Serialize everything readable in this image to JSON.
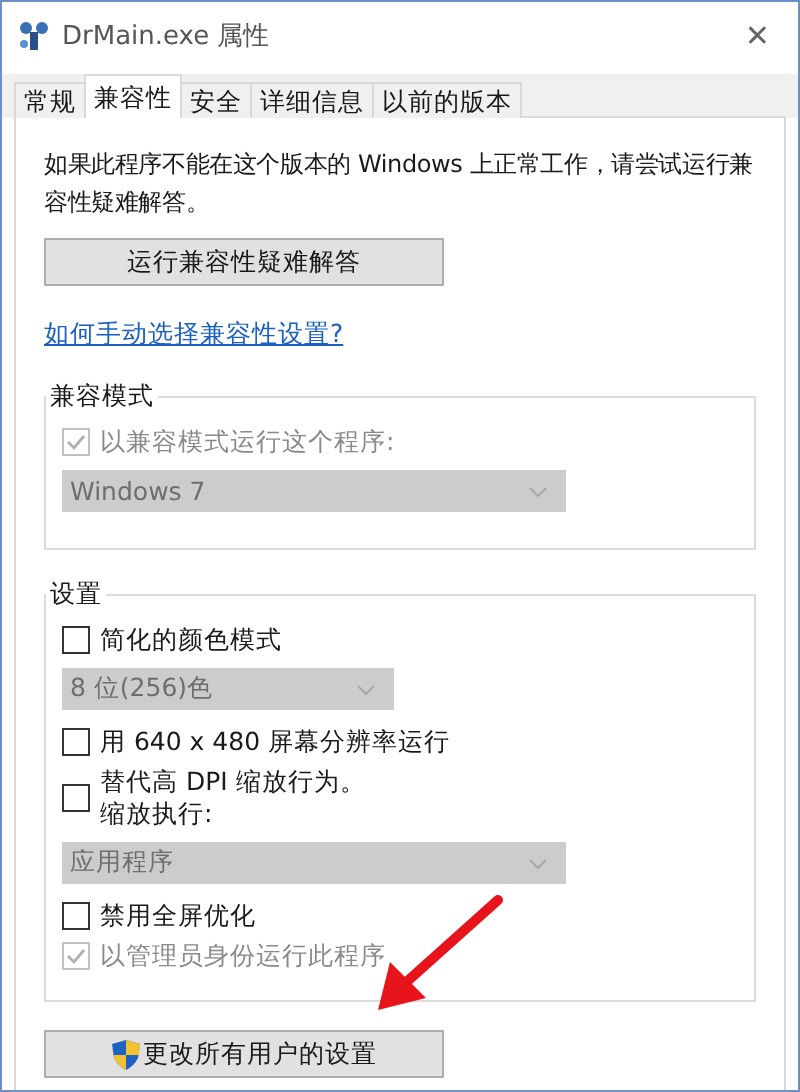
{
  "window": {
    "title": "DrMain.exe 属性",
    "close": "✕"
  },
  "tabs": [
    {
      "label": "常规",
      "selected": false
    },
    {
      "label": "兼容性",
      "selected": true
    },
    {
      "label": "安全",
      "selected": false
    },
    {
      "label": "详细信息",
      "selected": false
    },
    {
      "label": "以前的版本",
      "selected": false
    }
  ],
  "intro": "如果此程序不能在这个版本的 Windows 上正常工作，请尝试运行兼容性疑难解答。",
  "troubleshoot_button": "运行兼容性疑难解答",
  "help_link": "如何手动选择兼容性设置?",
  "groups": [
    {
      "title": "兼容模式",
      "items": [
        {
          "kind": "checkbox",
          "label": "以兼容模式运行这个程序:",
          "checked": true,
          "disabled": true
        },
        {
          "kind": "dropdown",
          "value": "Windows 7",
          "disabled": true
        }
      ]
    },
    {
      "title": "设置",
      "items": [
        {
          "kind": "checkbox",
          "label": "简化的颜色模式",
          "checked": false,
          "disabled": false
        },
        {
          "kind": "dropdown",
          "value": "8 位(256)色",
          "disabled": true,
          "short": true
        },
        {
          "kind": "checkbox",
          "label": "用 640 x 480 屏幕分辨率运行",
          "checked": false,
          "disabled": false
        },
        {
          "kind": "checkbox",
          "label": "替代高 DPI 缩放行为。",
          "label_2": "缩放执行:",
          "checked": false,
          "disabled": false
        },
        {
          "kind": "dropdown",
          "value": "应用程序",
          "disabled": true
        },
        {
          "kind": "checkbox",
          "label": "禁用全屏优化",
          "checked": false,
          "disabled": false
        },
        {
          "kind": "checkbox",
          "label": "以管理员身份运行此程序",
          "checked": true,
          "disabled": true
        }
      ]
    }
  ],
  "all_users_button": "更改所有用户的设置"
}
